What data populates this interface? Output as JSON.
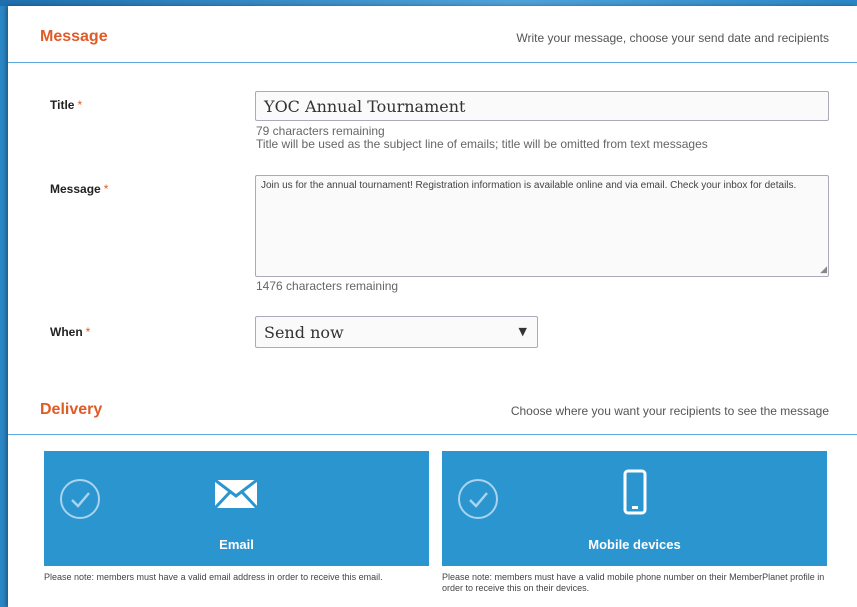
{
  "message_section": {
    "title": "Message",
    "subtitle": "Write your message, choose your send date and recipients"
  },
  "title_field": {
    "label": "Title",
    "required": "*",
    "value": "YOC Annual Tournament",
    "remaining": "79 characters remaining",
    "hint": "Title will be used as the subject line of emails; title will be omitted from text messages"
  },
  "message_field": {
    "label": "Message",
    "required": "*",
    "value": "Join us for the annual tournament! Registration information is available online and via email. Check your inbox for details.",
    "remaining": "1476 characters remaining"
  },
  "when_field": {
    "label": "When",
    "required": "*",
    "selected": "Send now"
  },
  "delivery_section": {
    "title": "Delivery",
    "subtitle": "Choose where you want your recipients to see the message"
  },
  "cards": {
    "email": {
      "label": "Email",
      "note": "Please note: members must have a valid email address in order to receive this email."
    },
    "mobile": {
      "label": "Mobile devices",
      "note": "Please note: members must have a valid mobile phone number on their MemberPlanet profile in order to receive this on their devices."
    }
  },
  "colors": {
    "accent": "#e05b26",
    "card_blue": "#2b95d0",
    "divider": "#5da9dc"
  }
}
